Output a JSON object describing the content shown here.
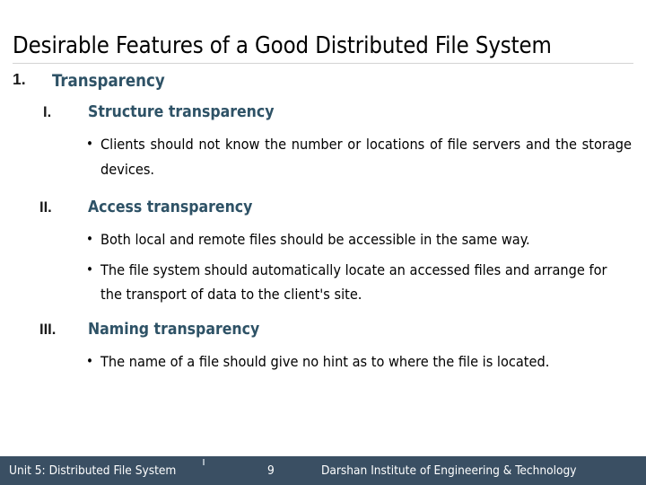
{
  "slide": {
    "title": "Desirable Features of a Good Distributed File System",
    "accent_color": "#2E5266",
    "title_color": "#000000",
    "rule_color": "#D4D4D4",
    "background": "#ffffff"
  },
  "outline": {
    "level1": {
      "marker": "1.",
      "heading": "Transparency"
    },
    "items": [
      {
        "marker": "I.",
        "heading": "Structure transparency",
        "bullets": [
          {
            "glyph": "•",
            "text": "Clients should not know the number or locations of file servers and the storage devices.",
            "justified": true
          }
        ]
      },
      {
        "marker": "II.",
        "heading": "Access transparency",
        "bullets": [
          {
            "glyph": "•",
            "text": "Both local and remote files should be accessible in the same way.",
            "justified": false
          },
          {
            "glyph": "•",
            "text": "The file system should automatically locate an accessed files and arrange for the transport of data to the client's site.",
            "justified": false
          }
        ]
      },
      {
        "marker": "III.",
        "heading": "Naming transparency",
        "bullets": [
          {
            "glyph": "•",
            "text": "The name of a file should give no hint as to where the file is located.",
            "justified": false
          }
        ]
      }
    ]
  },
  "footer": {
    "background": "#3A4F63",
    "text_color": "#FFFFFF",
    "unit": "Unit 5: Distributed File System",
    "page_number": "9",
    "institute": "Darshan Institute of Engineering & Technology"
  }
}
